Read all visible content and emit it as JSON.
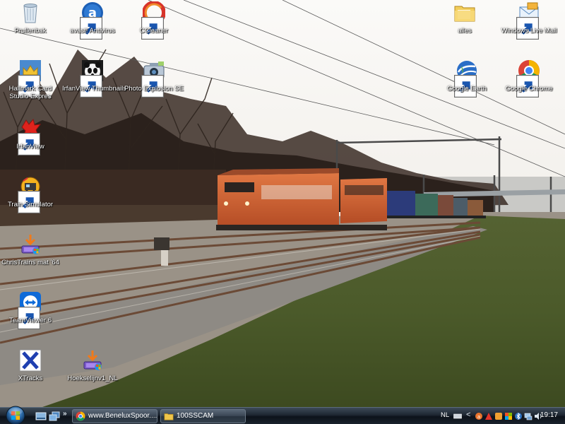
{
  "desktop": {
    "icons": [
      {
        "id": "recycle-bin",
        "label": "Prullenbak",
        "icon": "recycle-bin-icon",
        "shortcut": false
      },
      {
        "id": "avast",
        "label": "avast! Antivirus",
        "icon": "avast-icon",
        "shortcut": true
      },
      {
        "id": "ccleaner",
        "label": "CCleaner",
        "icon": "ccleaner-icon",
        "shortcut": true
      },
      {
        "id": "alles",
        "label": "alles",
        "icon": "folder-icon",
        "shortcut": false
      },
      {
        "id": "windows-live-mail",
        "label": "Windows Live Mail",
        "icon": "windows-live-mail-icon",
        "shortcut": true
      },
      {
        "id": "hallmark",
        "label": "Hallmark Card Studio Expres",
        "icon": "hallmark-crown-icon",
        "shortcut": true
      },
      {
        "id": "irfanview-thumbnails",
        "label": "IrfanView Thumbnails",
        "icon": "panda-icon",
        "shortcut": true
      },
      {
        "id": "photo-explosion",
        "label": "Photo Explosion SE",
        "icon": "camera-icon",
        "shortcut": true
      },
      {
        "id": "google-earth",
        "label": "Google Earth",
        "icon": "google-earth-icon",
        "shortcut": true
      },
      {
        "id": "google-chrome",
        "label": "Google Chrome",
        "icon": "chrome-icon",
        "shortcut": true
      },
      {
        "id": "irfanview",
        "label": "IrfanView",
        "icon": "red-cat-icon",
        "shortcut": true
      },
      {
        "id": "train-simulator",
        "label": "Train Simulator",
        "icon": "train-simulator-icon",
        "shortcut": true
      },
      {
        "id": "christrains",
        "label": "ChrisTrains mat '64",
        "icon": "installer-icon",
        "shortcut": false
      },
      {
        "id": "teamviewer",
        "label": "TeamViewer 6",
        "icon": "teamviewer-icon",
        "shortcut": true
      },
      {
        "id": "xtracks",
        "label": "XTracks",
        "icon": "xtracks-icon",
        "shortcut": false
      },
      {
        "id": "hoekselijn",
        "label": "Hoekselijnv1_NL",
        "icon": "installer-icon",
        "shortcut": false
      }
    ]
  },
  "taskbar": {
    "start_icon": "windows-orb-icon",
    "quick_launch": [
      "show-desktop-icon",
      "switch-windows-icon"
    ],
    "chevron": "»",
    "tasks": [
      {
        "label": "www.BeneluxSpoor....",
        "icon": "chrome-icon"
      },
      {
        "label": "100SSCAM",
        "icon": "folder-icon"
      }
    ],
    "tray": {
      "language": "NL",
      "collapse": "<",
      "clock": "19:17"
    }
  },
  "colors": {
    "taskbar": "#1d2631",
    "icon_label": "#ffffff",
    "sky": "#f4f2ee",
    "grass": "#4a5a2a",
    "locomotive": "#d8632e"
  }
}
